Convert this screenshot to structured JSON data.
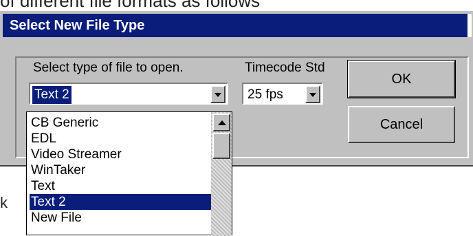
{
  "background_text": {
    "top_line": "of different file formats as follows",
    "left_fragment": "k"
  },
  "dialog": {
    "title": "Select New File Type",
    "file_type_label": "Select type of file to open.",
    "file_type_value": "Text 2",
    "timecode_label": "Timecode Std",
    "timecode_value": "25 fps",
    "ok_label": "OK",
    "cancel_label": "Cancel"
  },
  "file_type_list": {
    "items": [
      "CB Generic",
      "EDL",
      "Video Streamer",
      "WinTaker",
      "Text",
      "Text 2",
      "New File"
    ],
    "selected": "Text 2"
  },
  "colors": {
    "title_bar": "#0a1d7a",
    "selection": "#0a1d7a",
    "face": "#c0c0c0"
  }
}
